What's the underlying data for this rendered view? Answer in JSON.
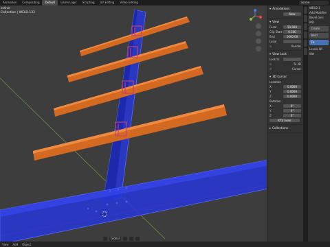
{
  "workspace_tabs": [
    "Animation",
    "Compositing",
    "Default",
    "Game Logic",
    "Scripting",
    "UV Editing",
    "Video Editing"
  ],
  "active_tab": "Default",
  "scene": "Scene",
  "viewport": {
    "overlay_line1": "ective",
    "overlay_line2": "Collection | WELD.133"
  },
  "npanel": {
    "annotations": {
      "title": "Annotations",
      "field": "New"
    },
    "view": {
      "title": "View",
      "focal_label": "Focal",
      "focal": "50.000",
      "clip_start_label": "Clip Start",
      "clip_start": "0.100",
      "end_label": "End",
      "end": "1000.00",
      "local_label": "Local",
      "render_label": "Render"
    },
    "view_lock": {
      "title": "View Lock",
      "lock_label": "Lock to",
      "lock_value": "To 3D",
      "cursor_label": "Cursor"
    },
    "cursor": {
      "title": "3D Cursor",
      "location_label": "Location",
      "x_label": "X",
      "x": "0.0000",
      "y_label": "Y",
      "y": "0.0000",
      "z_label": "Z",
      "z": "0.0000",
      "rotation_label": "Rotation",
      "rx_label": "X",
      "rx": "0°",
      "ry_label": "Y",
      "ry": "0°",
      "rz_label": "Z",
      "rz": "0°",
      "mode": "XYZ Euler"
    },
    "collections": {
      "title": "Collections"
    }
  },
  "props": {
    "header": "WELD.1",
    "item1": "Add Modifier",
    "item2": "Bevel Gen",
    "item3": "MD",
    "item4": "Create",
    "item5": "Weld",
    "item6": "Co",
    "item7": "Levels Wi",
    "item8": "Wel"
  },
  "statusbar": {
    "left1": "View",
    "left2": "Add",
    "left3": "Object",
    "mode": "Global"
  },
  "colors": {
    "beam": "#2230d0",
    "rail": "#d46a22",
    "weld": "#c9406a",
    "viewport": "#3d3d3d"
  }
}
